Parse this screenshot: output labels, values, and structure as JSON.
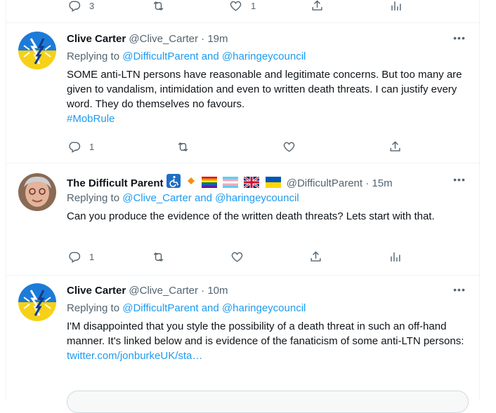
{
  "top_actions": {
    "reply_count": "3",
    "like_count": "1"
  },
  "tweets": [
    {
      "name": "Clive Carter",
      "handle": "@Clive_Carter",
      "time": "19m",
      "replying_prefix": "Replying to",
      "replying_to": "@DifficultParent and @haringeycouncil",
      "text": "SOME anti-LTN persons have reasonable and legitimate concerns. But too many are given to vandalism, intimidation and even to written death threats. I can justify every word. They do themselves no favours.",
      "hashtag": "#MobRule",
      "reply_count": "1"
    },
    {
      "name": "The Difficult Parent",
      "badges": "♿ 🔶 🏳️‍🌈 🏳️‍⚧️ 🇬🇧 🇺🇦",
      "handle": "@DifficultParent",
      "time": "15m",
      "replying_prefix": "Replying to",
      "replying_to": "@Clive_Carter and @haringeycouncil",
      "text": "Can you  produce the evidence of the written death threats? Lets start with that.",
      "reply_count": "1"
    },
    {
      "name": "Clive Carter",
      "handle": "@Clive_Carter",
      "time": "10m",
      "replying_prefix": "Replying to",
      "replying_to": "@DifficultParent and @haringeycouncil",
      "text": "I'M disappointed that you style the possibility of a death threat in such an off-hand manner. It's linked below and is evidence of the fanaticism of some anti-LTN persons:",
      "link": "twitter.com/jonburkeUK/sta…"
    }
  ],
  "colors": {
    "link": "#1d9bf0",
    "muted": "#536471",
    "text": "#0f1419",
    "border": "#eff3f4"
  }
}
